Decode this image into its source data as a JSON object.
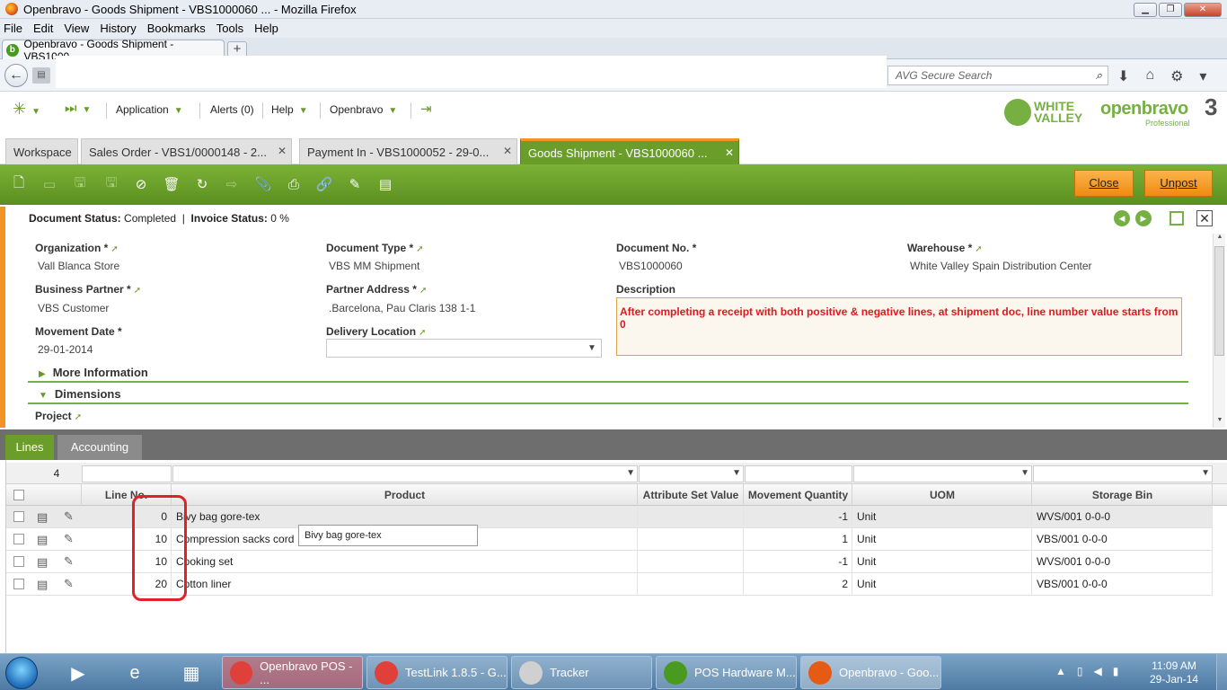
{
  "window": {
    "title": "Openbravo - Goods Shipment - VBS1000060 ... - Mozilla Firefox",
    "minimize": "▁",
    "maximize": "❐",
    "close": "✕"
  },
  "menubar": {
    "items": [
      "File",
      "Edit",
      "View",
      "History",
      "Bookmarks",
      "Tools",
      "Help"
    ]
  },
  "browser_tab": {
    "label": "Openbravo - Goods Shipment - VBS1000...",
    "favicon": "b",
    "new_tab": "+"
  },
  "navbar": {
    "search_placeholder": "AVG Secure Search"
  },
  "app_toolbar": {
    "application": "Application",
    "alerts": "Alerts (0)",
    "help": "Help",
    "openbravo": "Openbravo"
  },
  "logos": {
    "white_valley": [
      "WHITE",
      "VALLEY"
    ],
    "openbravo": "openbravo",
    "version": "3",
    "edition": "Professional"
  },
  "app_tabs": [
    {
      "label": "Workspace"
    },
    {
      "label": "Sales Order - VBS1/0000148 - 2..."
    },
    {
      "label": "Payment In - VBS1000052 - 29-0..."
    },
    {
      "label": "Goods Shipment - VBS1000060 ..."
    }
  ],
  "actions": {
    "close": "Close",
    "unpost": "Unpost"
  },
  "status": {
    "doc_status_label": "Document Status:",
    "doc_status_value": "Completed",
    "separator": "|",
    "invoice_status_label": "Invoice Status:",
    "invoice_status_value": "0 %"
  },
  "form": {
    "organization_label": "Organization *",
    "organization_value": "Vall Blanca Store",
    "document_type_label": "Document Type *",
    "document_type_value": "VBS MM Shipment",
    "document_no_label": "Document No. *",
    "document_no_value": "VBS1000060",
    "warehouse_label": "Warehouse *",
    "warehouse_value": "White Valley Spain Distribution Center",
    "business_partner_label": "Business Partner *",
    "business_partner_value": "VBS Customer",
    "partner_address_label": "Partner Address *",
    "partner_address_value": ".Barcelona, Pau Claris 138 1-1",
    "description_label": "Description",
    "description_value": "After completing a receipt with both positive & negative lines, at shipment doc, line number value starts from 0",
    "movement_date_label": "Movement Date *",
    "movement_date_value": "29-01-2014",
    "delivery_location_label": "Delivery Location",
    "more_information": "More Information",
    "dimensions": "Dimensions",
    "project_label": "Project"
  },
  "lower_tabs": [
    "Lines",
    "Accounting"
  ],
  "grid": {
    "filter_line_no": "4",
    "headers": [
      "Line No.",
      "Product",
      "Attribute Set Value",
      "Movement Quantity",
      "UOM",
      "Storage Bin"
    ],
    "rows": [
      {
        "line": "0",
        "product": "Bivy bag gore-tex",
        "attr": "",
        "qty": "-1",
        "uom": "Unit",
        "bin": "WVS/001 0-0-0"
      },
      {
        "line": "10",
        "product": "Compression sacks cord",
        "attr": "",
        "qty": "1",
        "uom": "Unit",
        "bin": "VBS/001 0-0-0"
      },
      {
        "line": "10",
        "product": "Cooking set",
        "attr": "",
        "qty": "-1",
        "uom": "Unit",
        "bin": "WVS/001 0-0-0"
      },
      {
        "line": "20",
        "product": "Cotton liner",
        "attr": "",
        "qty": "2",
        "uom": "Unit",
        "bin": "VBS/001 0-0-0"
      }
    ],
    "tooltip": "Bivy bag gore-tex"
  },
  "taskbar": {
    "buttons": [
      {
        "label": "Openbravo POS - ...",
        "color": "#e0403a"
      },
      {
        "label": "TestLink 1.8.5 - G...",
        "color": "#e0403a"
      },
      {
        "label": "Tracker",
        "color": "#d0d0d0"
      },
      {
        "label": "POS Hardware M...",
        "color": "#4a9a1f"
      },
      {
        "label": "Openbravo - Goo...",
        "color": "#e55b13"
      }
    ],
    "time": "11:09 AM",
    "date": "29-Jan-14"
  },
  "colors": {
    "accent_green": "#6b9d2a",
    "accent_orange": "#f39324",
    "highlight_red": "#e0212a"
  }
}
